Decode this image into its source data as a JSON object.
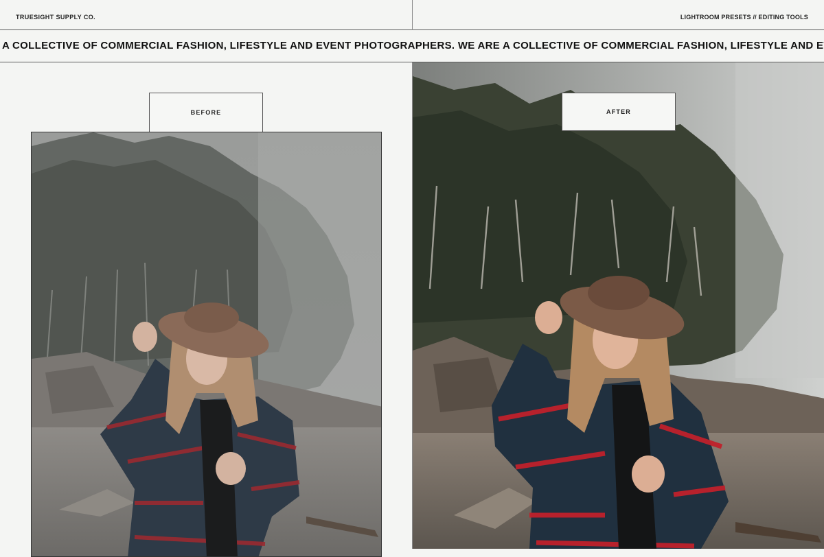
{
  "header": {
    "brand": "TRUESIGHT SUPPLY CO.",
    "tagline": "LIGHTROOM PRESETS // EDITING TOOLS"
  },
  "marquee": {
    "text": "A COLLECTIVE OF COMMERCIAL FASHION, LIFESTYLE AND EVENT PHOTOGRAPHERS. WE ARE A COLLECTIVE OF COMMERCIAL FASHION, LIFESTYLE AND EVENT PHOTOGRAPHERS."
  },
  "comparison": {
    "before_label": "BEFORE",
    "after_label": "AFTER"
  },
  "colors": {
    "background": "#f4f5f3",
    "border": "#5a5a5a",
    "before_tone": "#8c8e8b",
    "after_tone": "#5e625a",
    "flannel_red": "#b0222a",
    "flannel_navy": "#263443",
    "hat_brown": "#7b5a47"
  }
}
